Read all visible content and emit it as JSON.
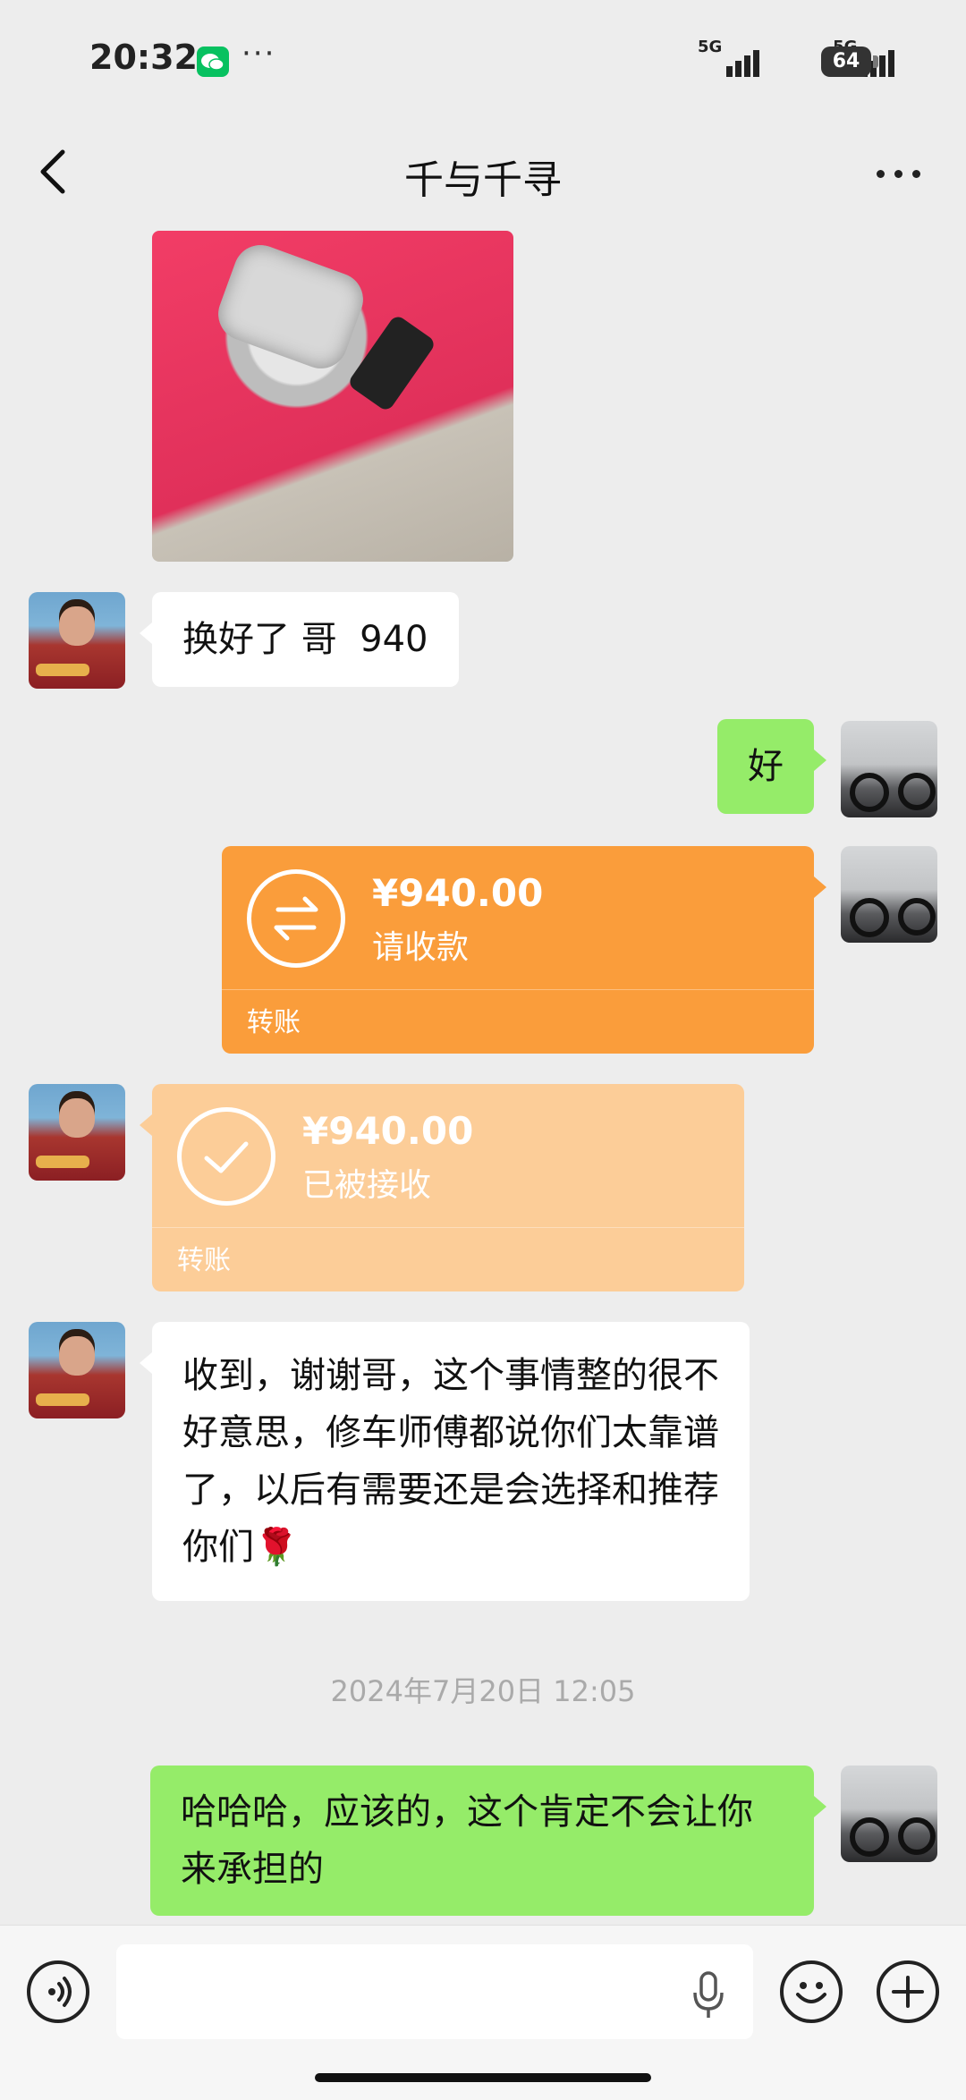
{
  "status_bar": {
    "time": "20:32",
    "more": "···",
    "signal_1": "5G",
    "signal_2": "5G",
    "battery": "64"
  },
  "header": {
    "title": "千与千寻"
  },
  "messages": {
    "m1_text": "换好了 哥  940",
    "m2_text": "好",
    "transfer_sent": {
      "amount": "¥940.00",
      "status": "请收款",
      "label": "转账"
    },
    "transfer_received": {
      "amount": "¥940.00",
      "status": "已被接收",
      "label": "转账"
    },
    "m3_text": "收到，谢谢哥，这个事情整的很不好意思，修车师傅都说你们太靠谱了，以后有需要还是会选择和推荐你们🌹",
    "timestamp": "2024年7月20日 12:05",
    "m4_text": "哈哈哈，应该的，这个肯定不会让你来承担的"
  },
  "colors": {
    "bubble_green": "#95ec69",
    "transfer_orange": "#fa9d3b",
    "transfer_received": "#fccd98",
    "background": "#ededed"
  },
  "icons": {
    "back": "chevron-left-icon",
    "more": "more-dots-icon",
    "voice": "voice-icon",
    "mic": "mic-icon",
    "emoji": "emoji-icon",
    "plus": "plus-icon"
  }
}
